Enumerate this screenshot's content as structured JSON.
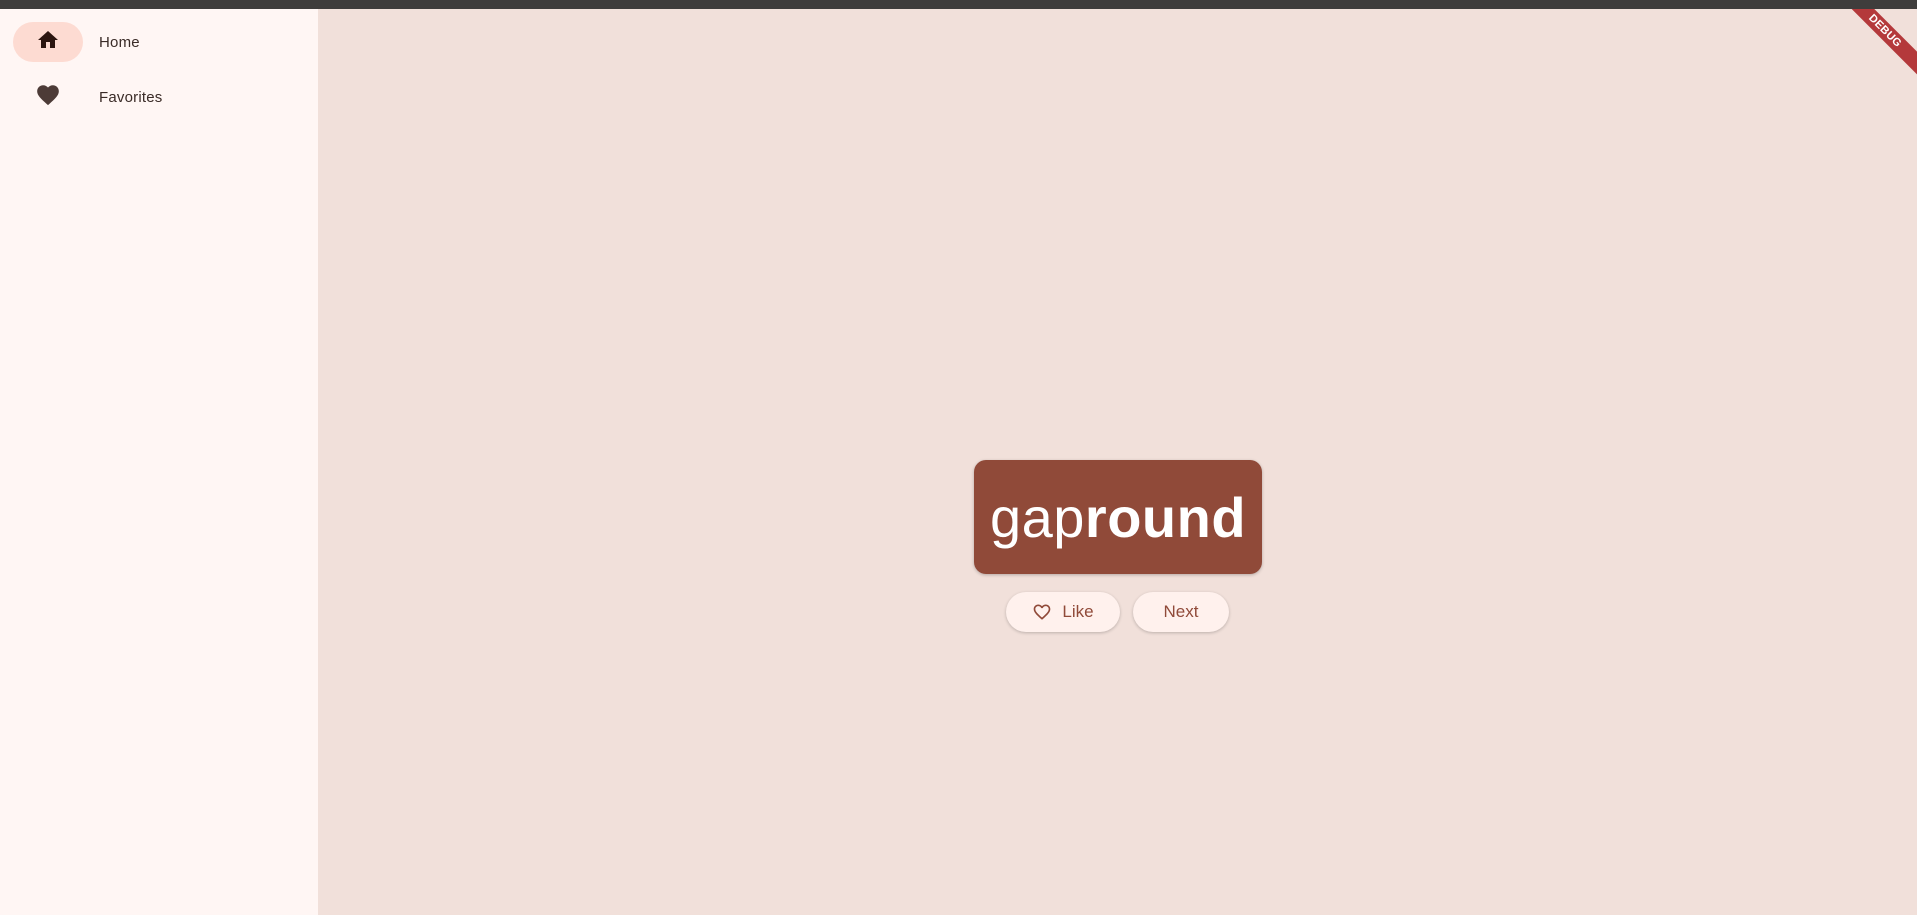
{
  "nav": {
    "items": [
      {
        "label": "Home",
        "icon": "home-icon",
        "selected": true
      },
      {
        "label": "Favorites",
        "icon": "heart-icon",
        "selected": false
      }
    ]
  },
  "main": {
    "word": {
      "first": "gap",
      "second": "round"
    },
    "like_label": "Like",
    "next_label": "Next"
  },
  "debug_banner": "DEBUG",
  "colors": {
    "primary": "#904a39",
    "background": "#f1e0da",
    "nav_background": "#fff6f4",
    "nav_indicator": "#fddbd2",
    "button_background": "#fff1ed",
    "debug_ribbon": "#b4393b"
  }
}
